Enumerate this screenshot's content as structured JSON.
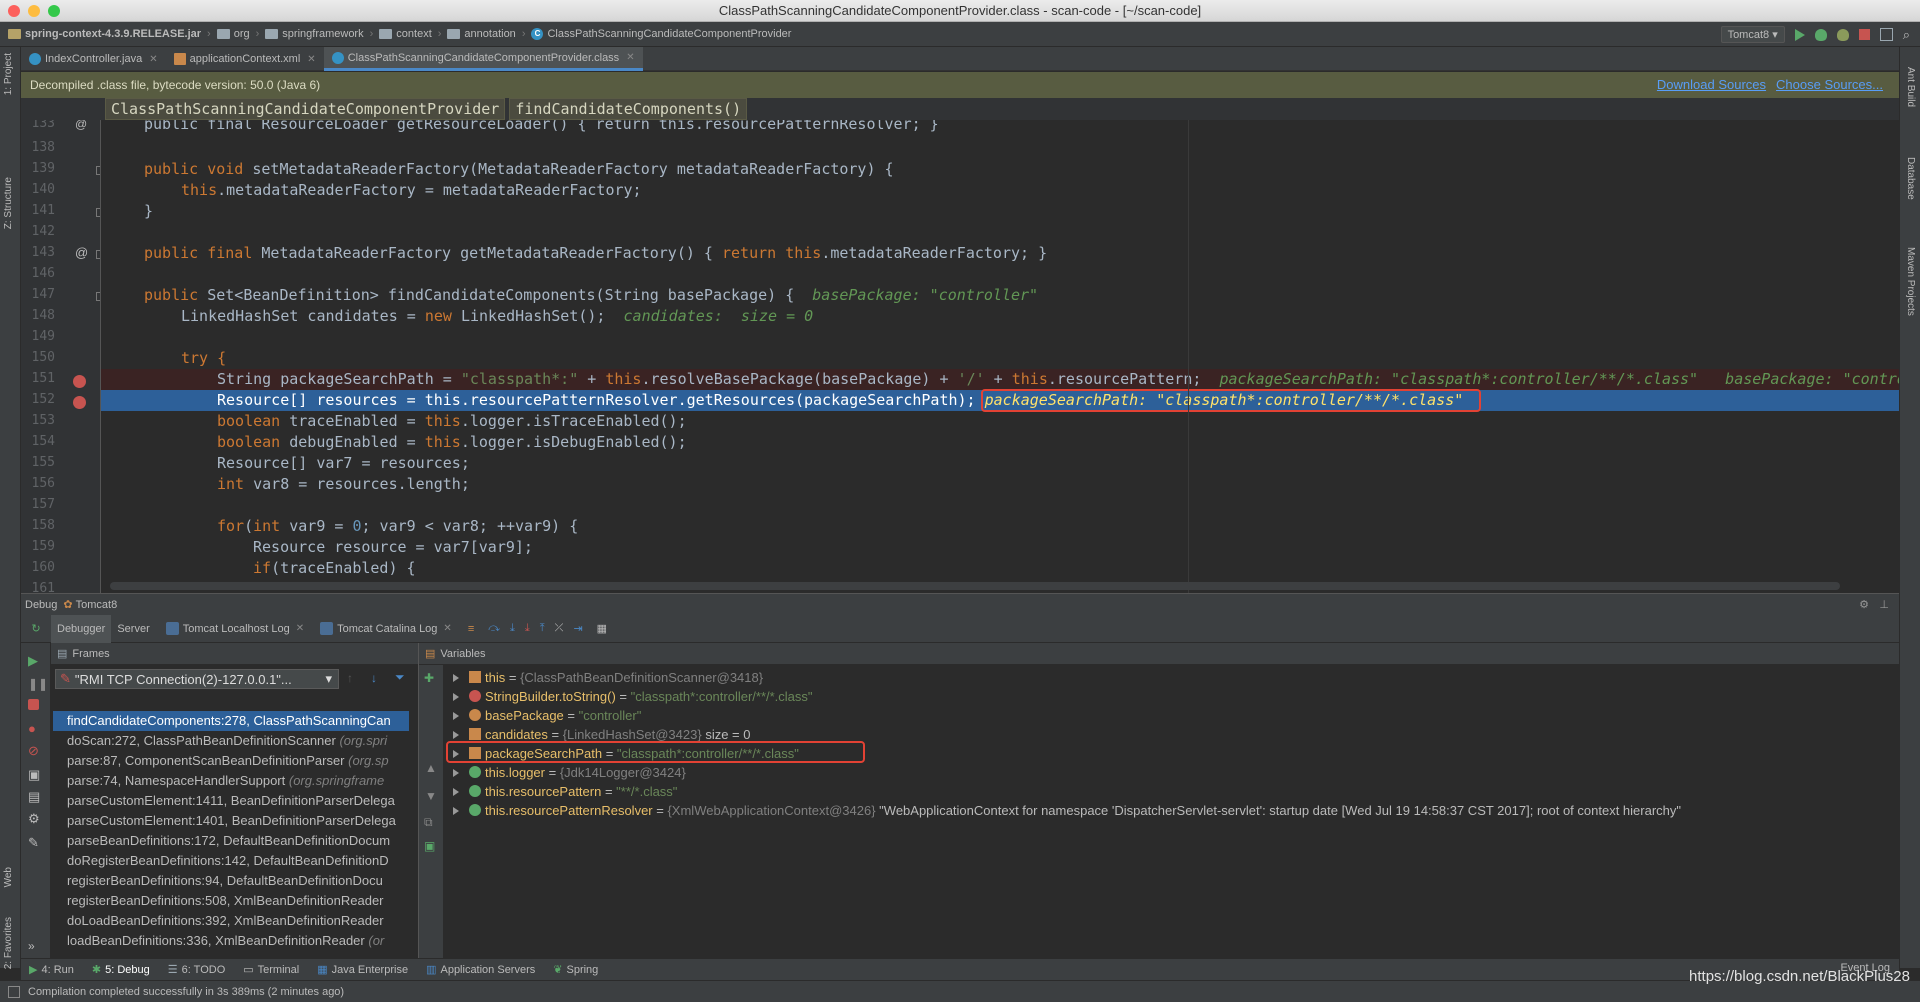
{
  "window": {
    "title": "ClassPathScanningCandidateComponentProvider.class - scan-code - [~/scan-code]"
  },
  "navbar": {
    "crumbs": [
      "spring-context-4.3.9.RELEASE.jar",
      "org",
      "springframework",
      "context",
      "annotation",
      "ClassPathScanningCandidateComponentProvider"
    ],
    "run_config": "Tomcat8"
  },
  "side_labels": {
    "project": "1: Project",
    "structure": "Z: Structure",
    "web": "Web",
    "favorites": "2: Favorites",
    "ant": "Ant Build",
    "database": "Database",
    "maven": "Maven Projects"
  },
  "tabs": [
    {
      "label": "IndexController.java"
    },
    {
      "label": "applicationContext.xml"
    },
    {
      "label": "ClassPathScanningCandidateComponentProvider.class"
    }
  ],
  "banner": {
    "text": "Decompiled .class file, bytecode version: 50.0 (Java 6)",
    "download": "Download Sources",
    "choose": "Choose Sources..."
  },
  "breadcrumb": {
    "class": "ClassPathScanningCandidateComponentProvider",
    "method": "findCandidateComponents()"
  },
  "code": {
    "line_numbers": [
      "133",
      "138",
      "139",
      "140",
      "141",
      "142",
      "143",
      "146",
      "147",
      "148",
      "149",
      "150",
      "151",
      "152",
      "153",
      "154",
      "155",
      "156",
      "157",
      "158",
      "159",
      "160",
      "161"
    ],
    "l133": "public final ResourceLoader getResourceLoader() { return this.resourcePatternResolver; }",
    "l139_a": "public void ",
    "l139_b": "setMetadataReaderFactory(MetadataReaderFactory metadataReaderFactory) {",
    "l140_a": "this",
    "l140_b": ".metadataReaderFactory = metadataReaderFactory;",
    "l141": "}",
    "l143_a": "public final ",
    "l143_b": "MetadataReaderFactory getMetadataReaderFactory() { ",
    "l143_c": "return this",
    "l143_d": ".metadataReaderFactory; }",
    "l147_a": "public ",
    "l147_b": "Set<BeanDefinition> findCandidateComponents(String basePackage) {  ",
    "l147_hint": "basePackage: \"controller\"",
    "l148_a": "LinkedHashSet candidates = ",
    "l148_b": "new ",
    "l148_c": "LinkedHashSet();  ",
    "l148_hint": "candidates:  size = 0",
    "l150": "try {",
    "l151_a": "String packageSearchPath = ",
    "l151_b": "\"classpath*:\"",
    "l151_c": " + ",
    "l151_d": "this",
    "l151_e": ".resolveBasePackage(basePackage) + ",
    "l151_f": "'/'",
    "l151_g": " + ",
    "l151_h": "this",
    "l151_i": ".resourcePattern;  ",
    "l151_hint": "packageSearchPath: \"classpath*:controller/**/*.class\"   basePackage: \"controll",
    "l152_a": "Resource[] resources = this.resourcePatternResolver.getResources(packageSearchPath); ",
    "l152_hint": "packageSearchPath: \"classpath*:controller/**/*.class\"",
    "l153_a": "boolean ",
    "l153_b": "traceEnabled = ",
    "l153_c": "this",
    "l153_d": ".logger.isTraceEnabled();",
    "l154_a": "boolean ",
    "l154_b": "debugEnabled = ",
    "l154_c": "this",
    "l154_d": ".logger.isDebugEnabled();",
    "l155": "Resource[] var7 = resources;",
    "l156_a": "int ",
    "l156_b": "var8 = resources.length;",
    "l158_a": "for",
    "l158_b": "(",
    "l158_c": "int ",
    "l158_d": "var9 = ",
    "l158_e": "0",
    "l158_f": "; var9 < var8; ++var9) {",
    "l159": "Resource resource = var7[var9];",
    "l160_a": "if",
    "l160_b": "(traceEnabled) {"
  },
  "debug": {
    "title": "Debug",
    "config": "Tomcat8",
    "tabs": [
      "Debugger",
      "Server",
      "Tomcat Localhost Log",
      "Tomcat Catalina Log"
    ],
    "frames_title": "Frames",
    "thread": "\"RMI TCP Connection(2)-127.0.0.1\"...",
    "frames": [
      {
        "name": "findCandidateComponents:278, ClassPathScanningCan",
        "loc": ""
      },
      {
        "name": "doScan:272, ClassPathBeanDefinitionScanner ",
        "loc": "(org.spri"
      },
      {
        "name": "parse:87, ComponentScanBeanDefinitionParser ",
        "loc": "(org.sp"
      },
      {
        "name": "parse:74, NamespaceHandlerSupport ",
        "loc": "(org.springframe"
      },
      {
        "name": "parseCustomElement:1411, BeanDefinitionParserDelega",
        "loc": ""
      },
      {
        "name": "parseCustomElement:1401, BeanDefinitionParserDelega",
        "loc": ""
      },
      {
        "name": "parseBeanDefinitions:172, DefaultBeanDefinitionDocum",
        "loc": ""
      },
      {
        "name": "doRegisterBeanDefinitions:142, DefaultBeanDefinitionD",
        "loc": ""
      },
      {
        "name": "registerBeanDefinitions:94, DefaultBeanDefinitionDocu",
        "loc": ""
      },
      {
        "name": "registerBeanDefinitions:508, XmlBeanDefinitionReader",
        "loc": ""
      },
      {
        "name": "doLoadBeanDefinitions:392, XmlBeanDefinitionReader",
        "loc": ""
      },
      {
        "name": "loadBeanDefinitions:336, XmlBeanDefinitionReader ",
        "loc": "(or"
      }
    ],
    "variables_title": "Variables",
    "variables": [
      {
        "name": "this",
        "eq": " = ",
        "obj": "{ClassPathBeanDefinitionScanner@3418}",
        "val": ""
      },
      {
        "name": "StringBuilder.toString()",
        "eq": " = ",
        "obj": "",
        "val": "\"classpath*:controller/**/*.class\""
      },
      {
        "name": "basePackage",
        "eq": " = ",
        "obj": "",
        "val": "\"controller\""
      },
      {
        "name": "candidates",
        "eq": " = ",
        "obj": "{LinkedHashSet@3423}",
        "val": "  size = 0"
      },
      {
        "name": "packageSearchPath",
        "eq": " = ",
        "obj": "",
        "val": "\"classpath*:controller/**/*.class\""
      },
      {
        "name": "this.logger",
        "eq": " = ",
        "obj": "{Jdk14Logger@3424}",
        "val": ""
      },
      {
        "name": "this.resourcePattern",
        "eq": " = ",
        "obj": "",
        "val": "\"**/*.class\""
      },
      {
        "name": "this.resourcePatternResolver",
        "eq": " = ",
        "obj": "{XmlWebApplicationContext@3426}",
        "val": " \"WebApplicationContext for namespace 'DispatcherServlet-servlet': startup date [Wed Jul 19 14:58:37 CST 2017]; root of context hierarchy\""
      }
    ]
  },
  "bottom_tabs": [
    "4: Run",
    "5: Debug",
    "6: TODO",
    "Terminal",
    "Java Enterprise",
    "Application Servers",
    "Spring"
  ],
  "event_log": "Event Log",
  "status": {
    "text": "Compilation completed successfully in 3s 389ms (2 minutes ago)",
    "watermark": "https://blog.csdn.net/BlackPlus28"
  },
  "colors": {
    "selection": "#2d6099",
    "keyword": "#cc7832",
    "string": "#6a8759",
    "hint": "#629755",
    "highlight_box": "#e34234"
  }
}
